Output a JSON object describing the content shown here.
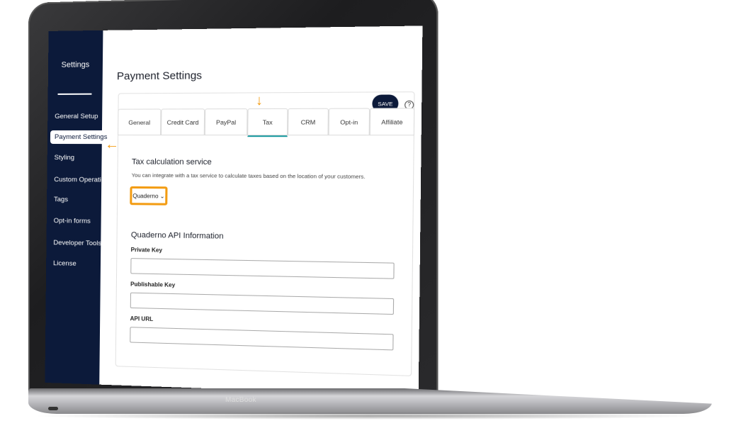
{
  "device": {
    "brand": "MacBook"
  },
  "sidebar": {
    "title": "Settings",
    "items": [
      {
        "label": "General Setup"
      },
      {
        "label": "Payment Settings",
        "active": true
      },
      {
        "label": "Styling"
      },
      {
        "label": "Custom Operations"
      },
      {
        "label": "Tags"
      },
      {
        "label": "Opt-in forms"
      },
      {
        "label": "Developer Tools"
      },
      {
        "label": "License"
      }
    ]
  },
  "header": {
    "title": "Payment Settings",
    "save_label": "SAVE",
    "help_label": "?"
  },
  "tabs": [
    {
      "label": "General"
    },
    {
      "label": "Credit Card"
    },
    {
      "label": "PayPal"
    },
    {
      "label": "Tax",
      "active": true
    },
    {
      "label": "CRM"
    },
    {
      "label": "Opt-in"
    },
    {
      "label": "Affiliate"
    }
  ],
  "tax": {
    "section_title": "Tax calculation service",
    "description": "You can integrate with a tax service to calculate taxes based on the location of your customers.",
    "service_selected": "Quaderno"
  },
  "api": {
    "section_title": "Quaderno API Information",
    "private_key_label": "Private Key",
    "private_key_value": "",
    "publishable_key_label": "Publishable Key",
    "publishable_key_value": "",
    "api_url_label": "API URL",
    "api_url_value": ""
  },
  "colors": {
    "sidebar_bg": "#0c1a3a",
    "accent_orange": "#f39c12",
    "active_tab_underline": "#1a9aa0"
  },
  "icons": {
    "arrow_down": "arrow-down-icon",
    "arrow_left": "arrow-left-icon",
    "chevron": "chevron-down-icon",
    "help": "help-icon"
  }
}
